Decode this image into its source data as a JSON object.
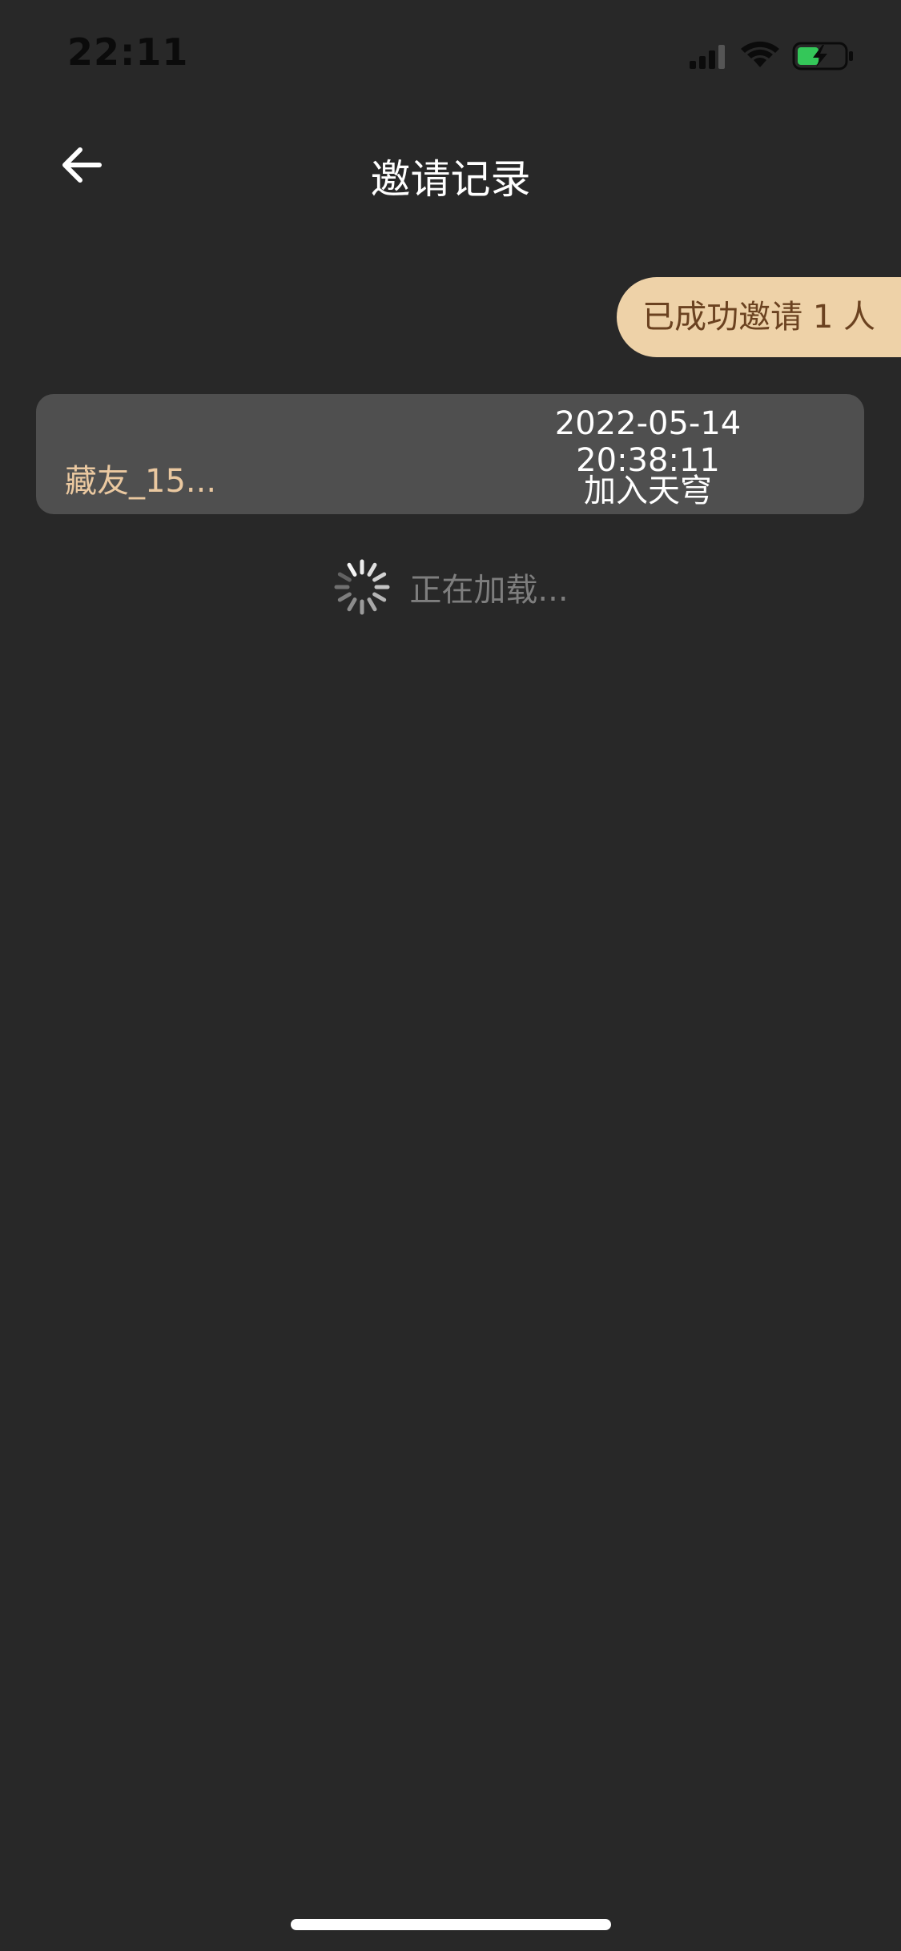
{
  "status_bar": {
    "time": "22:11",
    "icons": [
      "signal-icon",
      "wifi-icon",
      "battery-charging-icon"
    ]
  },
  "header": {
    "back_icon": "arrow-left-icon",
    "title": "邀请记录"
  },
  "summary": {
    "label": "已成功邀请 1 人"
  },
  "records": [
    {
      "name": "藏友_15...",
      "datetime": "2022-05-14 20:38:11",
      "status": "加入天穹"
    }
  ],
  "loading": {
    "text": "正在加载..."
  },
  "colors": {
    "background": "#282828",
    "card": "#4f4f4f",
    "accent_pill": "#eed2a8",
    "accent_pill_text": "#6b4220",
    "name_text": "#eac8a0",
    "muted_text": "#7e7e7e",
    "battery_fill": "#34c759"
  }
}
